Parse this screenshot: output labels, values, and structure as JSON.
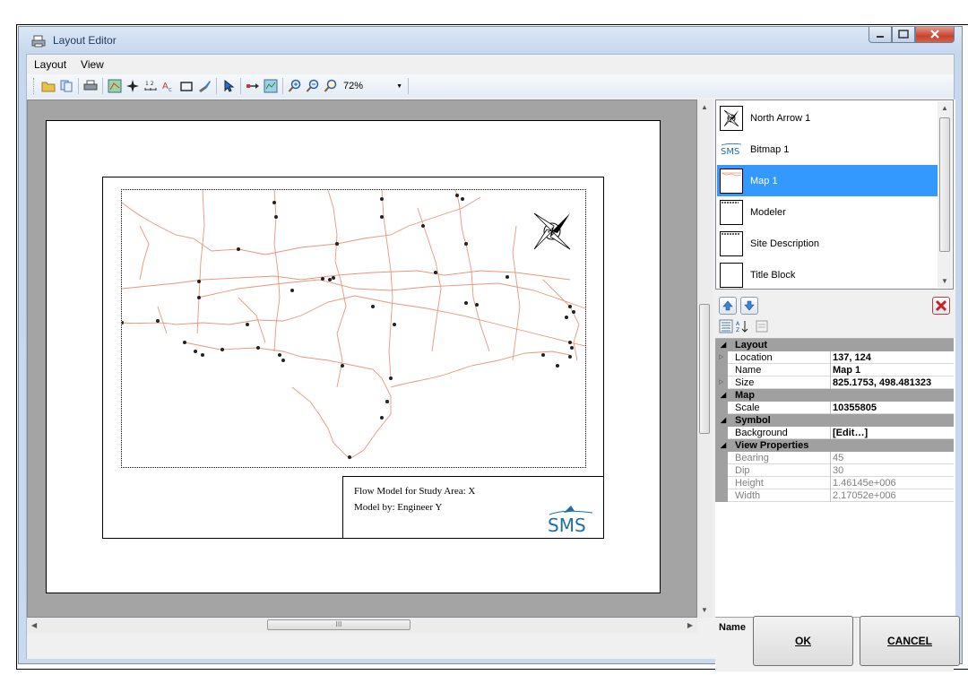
{
  "window": {
    "title": "Layout Editor"
  },
  "menu": {
    "layout": "Layout",
    "view": "View"
  },
  "toolbar": {
    "zoom": "72%"
  },
  "title_block": {
    "line1": "Flow Model for Study Area: X",
    "line2": "Model by: Engineer Y"
  },
  "logo": {
    "text": "SMS"
  },
  "items": [
    {
      "label": "North Arrow 1"
    },
    {
      "label": "Bitmap 1"
    },
    {
      "label": "Map 1"
    },
    {
      "label": "Modeler"
    },
    {
      "label": "Site Description"
    },
    {
      "label": "Title Block"
    }
  ],
  "properties": {
    "cat_layout": "Layout",
    "location_label": "Location",
    "location_value": "137, 124",
    "name_label": "Name",
    "name_value": "Map 1",
    "size_label": "Size",
    "size_value": "825.1753, 498.481323",
    "cat_map": "Map",
    "scale_label": "Scale",
    "scale_value": "10355805",
    "cat_symbol": "Symbol",
    "background_label": "Background",
    "background_value": "[Edit…]",
    "cat_view": "View Properties",
    "bearing_label": "Bearing",
    "bearing_value": "45",
    "dip_label": "Dip",
    "dip_value": "30",
    "height_label": "Height",
    "height_value": "1.46145e+006",
    "width_label": "Width",
    "width_value": "2.17052e+006"
  },
  "description": {
    "title": "Name"
  },
  "buttons": {
    "ok": "OK",
    "cancel": "CANCEL"
  },
  "colors": {
    "selection": "#3399ff",
    "map_lines": "#e8967a",
    "map_nodes": "#222222",
    "logo": "#1c6fae",
    "delete": "#cc1f1f"
  }
}
